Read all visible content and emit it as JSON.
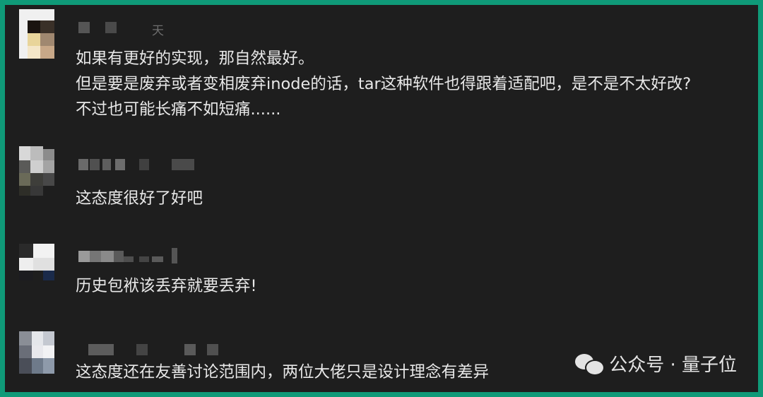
{
  "colors": {
    "border": "#0f9a78",
    "background": "#1e1e1e",
    "text": "#e8e8e8"
  },
  "comments": [
    {
      "username_visible": "天",
      "lines": [
        "如果有更好的实现，那自然最好。",
        "但是要是废弃或者变相废弃inode的话，tar这种软件也得跟着适配吧，是不是不太好改?",
        "不过也可能长痛不如短痛......"
      ]
    },
    {
      "lines": [
        "这态度很好了好吧"
      ]
    },
    {
      "lines": [
        "历史包袱该丢弃就要丢弃!"
      ]
    },
    {
      "lines": [
        "这态度还在友善讨论范围内，两位大佬只是设计理念有差异"
      ]
    }
  ],
  "watermark": {
    "icon": "wechat-icon",
    "text": "公众号 · 量子位"
  }
}
